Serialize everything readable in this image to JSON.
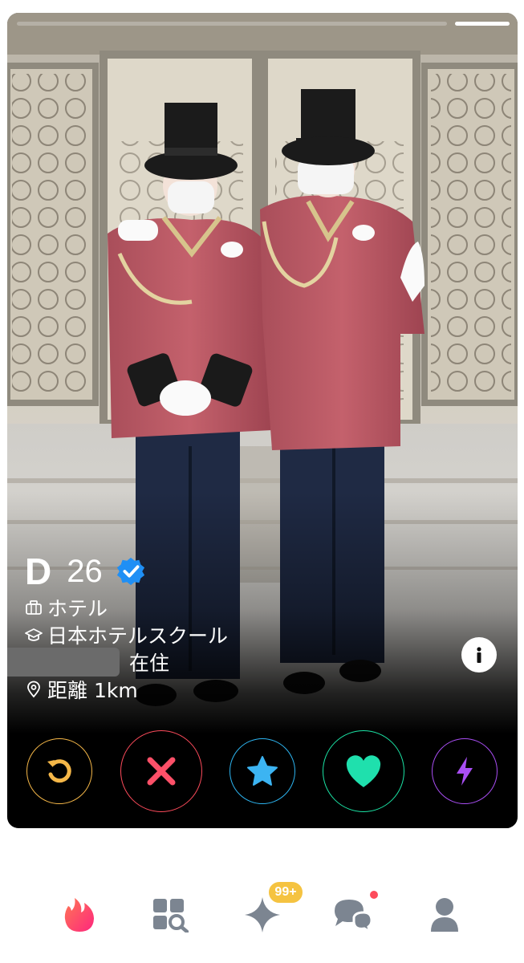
{
  "profile": {
    "name": "D",
    "age": "26",
    "job": "ホテル",
    "school": "日本ホテルスクール",
    "residence_suffix": "在住",
    "distance": "距離 1km"
  },
  "icons": {
    "verified": "verified-badge-icon",
    "job": "briefcase-icon",
    "school": "graduation-cap-icon",
    "location": "location-pin-icon",
    "info": "info-icon"
  },
  "actions": [
    {
      "name": "rewind",
      "icon": "rewind-icon",
      "color": "#f5b748"
    },
    {
      "name": "nope",
      "icon": "close-icon",
      "color": "#fd4b5b"
    },
    {
      "name": "super-like",
      "icon": "star-icon",
      "color": "#2db5f1"
    },
    {
      "name": "like",
      "icon": "heart-icon",
      "color": "#1be4a5"
    },
    {
      "name": "boost",
      "icon": "lightning-icon",
      "color": "#a94ef4"
    }
  ],
  "nav": {
    "badge": "99+",
    "items": [
      "flame-icon",
      "explore-icon",
      "sparkle-icon",
      "chat-icon",
      "profile-icon"
    ]
  }
}
